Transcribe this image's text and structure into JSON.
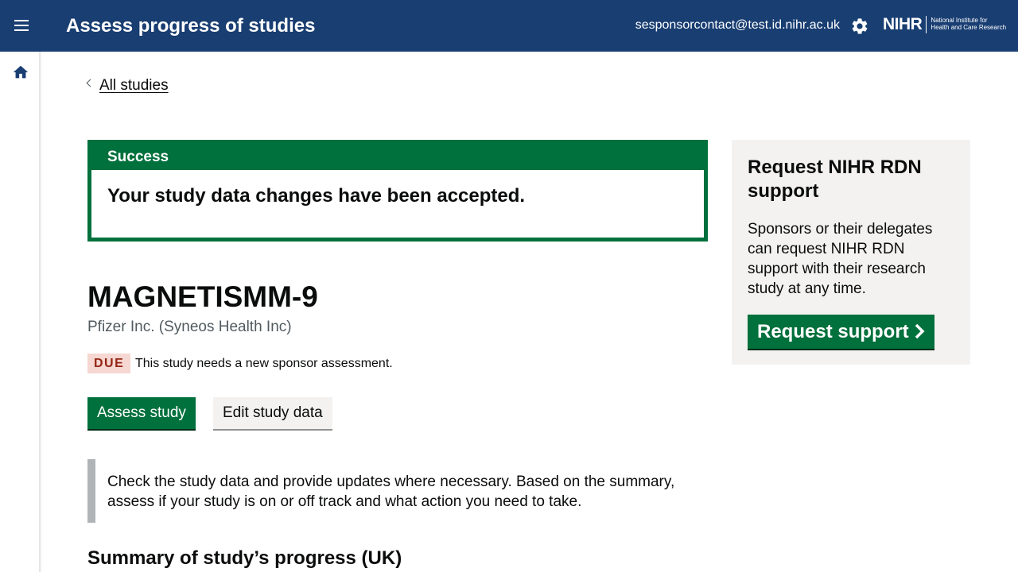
{
  "header": {
    "title": "Assess progress of studies",
    "user_email": "sesponsorcontact@test.id.nihr.ac.uk",
    "logo_main": "NIHR",
    "logo_sub_line1": "National Institute for",
    "logo_sub_line2": "Health and Care Research",
    "colors": {
      "background": "#193e72",
      "text": "#ffffff"
    },
    "icons": {
      "menu": "menu-icon",
      "settings": "gear-icon"
    }
  },
  "sidebar": {
    "icons": {
      "home": "home-icon"
    }
  },
  "breadcrumb": {
    "back_label": "All studies"
  },
  "success_banner": {
    "title": "Success",
    "message": "Your study data changes have been accepted.",
    "color": "#00703c"
  },
  "study": {
    "title": "MAGNETISMM-9",
    "sponsor": "Pfizer Inc. (Syneos Health Inc)",
    "status_tag": "DUE",
    "status_text": "This study needs a new sponsor assessment.",
    "tag_colors": {
      "background": "#f6d7d2",
      "text": "#942514"
    }
  },
  "actions": {
    "assess_label": "Assess study",
    "edit_label": "Edit study data"
  },
  "inset_text": "Check the study data and provide updates where necessary. Based on the summary, assess if your study is on or off track and what action you need to take.",
  "summary_heading": "Summary of study’s progress (UK)",
  "support_panel": {
    "title": "Request NIHR RDN support",
    "body": "Sponsors or their delegates can request NIHR RDN support with their research study at any time.",
    "button_label": "Request support",
    "button_icon": "chevron-right-icon"
  }
}
